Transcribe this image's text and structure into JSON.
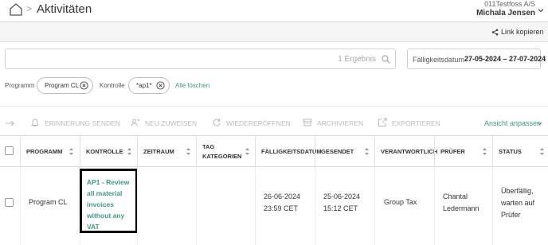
{
  "header": {
    "title": "Aktivitäten",
    "separator": ">",
    "company": "011Testfoss A/S",
    "user": "Michala Jensen"
  },
  "subbar": {
    "copy_link": "Link kopieren"
  },
  "search": {
    "value": "",
    "result_count": "1 Ergebnis"
  },
  "date_filter": {
    "label": "Fälligkeitsdatum",
    "value": "27-05-2024 – 27-07-2024"
  },
  "filters": {
    "program_label": "Programm",
    "program_chip": "Program CL",
    "control_label": "Kontrolle",
    "control_chip": "*ap1*",
    "clear_all": "Alle löschen"
  },
  "toolbar": {
    "reminder": "ERINNERUNG SENDEN",
    "reassign": "NEU ZUWEISEN",
    "reopen": "WIEDERERÖFFNEN",
    "archive": "ARCHIVIEREN",
    "export": "EXPORTIEREN",
    "view_adjust": "Ansicht anpassen"
  },
  "table": {
    "headers": {
      "program": "PROGRAMM",
      "control": "KONTROLLE",
      "period": "ZEITRAUM",
      "tag_line1": "TAG",
      "tag_line2": "KATEGORIEN",
      "due_date": "FÄLLIGKEITSDATUM",
      "sent": "GESENDET",
      "responsible": "VERANTWORTLICH",
      "reviewer": "PRÜFER",
      "status": "STATUS"
    },
    "rows": [
      {
        "program": "Program CL",
        "control_lines": [
          "AP1 - Review",
          "all material",
          "invoices",
          "without any",
          "VAT"
        ],
        "period": "",
        "tags": "",
        "due_date_line1": "26-06-2024",
        "due_date_line2": "23:59 CET",
        "sent_line1": "25-06-2024",
        "sent_line2": "15:12 CET",
        "responsible": "Group Tax",
        "reviewer_line1": "Chantal",
        "reviewer_line2": "Ledermann",
        "status_lines": [
          "Überfällig,",
          "warten auf",
          "Prüfer"
        ]
      }
    ]
  },
  "colors": {
    "accent": "#3a9b86",
    "disabled": "#bbbbbb",
    "border": "#dcdcdc"
  },
  "icons": {
    "home": "home-icon",
    "share": "share-icon",
    "search": "search-icon",
    "close": "close-icon",
    "bell": "bell-icon",
    "reassign": "users-icon",
    "reopen": "refresh-icon",
    "archive": "archive-icon",
    "export": "export-icon",
    "forward": "arrow-icon",
    "sort": "sort-icon",
    "chevron": "chevron-down-icon"
  }
}
